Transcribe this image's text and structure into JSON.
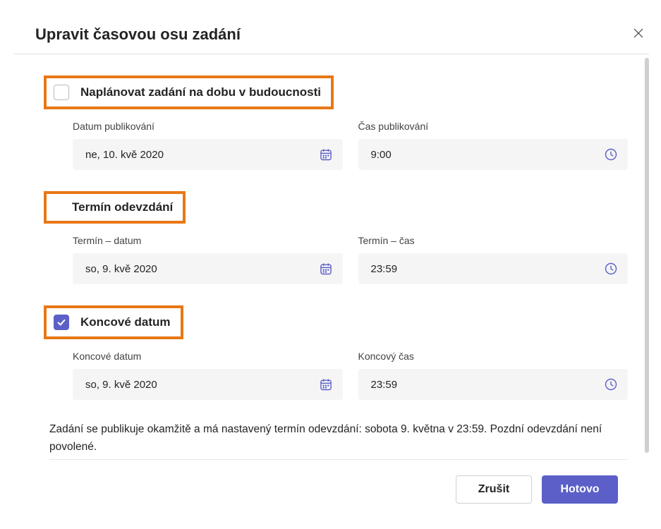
{
  "dialog": {
    "title": "Upravit časovou osu zadání",
    "close": "×"
  },
  "schedule": {
    "checkbox_label": "Naplánovat zadání na dobu v budoucnosti",
    "checked": false,
    "date_label": "Datum publikování",
    "date_value": "ne, 10. kvě 2020",
    "time_label": "Čas publikování",
    "time_value": "9:00"
  },
  "due": {
    "heading": "Termín odevzdání",
    "date_label": "Termín – datum",
    "date_value": "so, 9. kvě 2020",
    "time_label": "Termín – čas",
    "time_value": "23:59"
  },
  "close_date": {
    "heading": "Koncové datum",
    "checked": true,
    "date_label": "Koncové datum",
    "date_value": "so, 9. kvě 2020",
    "time_label": "Koncový čas",
    "time_value": "23:59"
  },
  "summary": "Zadání se publikuje okamžitě a má nastavený termín odevzdání: sobota 9. května v 23:59. Pozdní odevzdání není povolené.",
  "footer": {
    "cancel": "Zrušit",
    "done": "Hotovo"
  },
  "highlight_color": "#e77817",
  "accent_color": "#5b5fc7"
}
